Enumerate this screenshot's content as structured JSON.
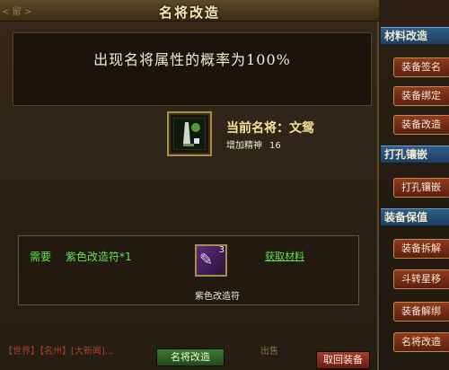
{
  "dialog": {
    "title": "名将改造",
    "top_left_tag": "< 留 >",
    "banner": "出现名将属性的概率为100%",
    "current": {
      "label": "当前名将：文鸳",
      "bonus_text": "增加精神",
      "bonus_value": "16"
    },
    "requirement": {
      "label": "需要",
      "item": "紫色改造符*1",
      "slot_qty": "3",
      "slot_caption": "紫色改造符",
      "link": "获取材料"
    },
    "chat": {
      "line1": "【世界】【名州】[大新闻]...",
      "line2": "出售"
    },
    "buttons": {
      "transform": "名将改造",
      "retrieve": "取回装备"
    }
  },
  "sidebar": {
    "sections": [
      {
        "title": "材料改造",
        "items": [
          "装备签名",
          "装备绑定",
          "装备改造"
        ]
      },
      {
        "title": "打孔镶嵌",
        "items": [
          "打孔镶嵌"
        ]
      },
      {
        "title": "装备保值",
        "items": [
          "装备拆解",
          "斗转星移",
          "装备解绑",
          "名将改造"
        ]
      }
    ]
  }
}
